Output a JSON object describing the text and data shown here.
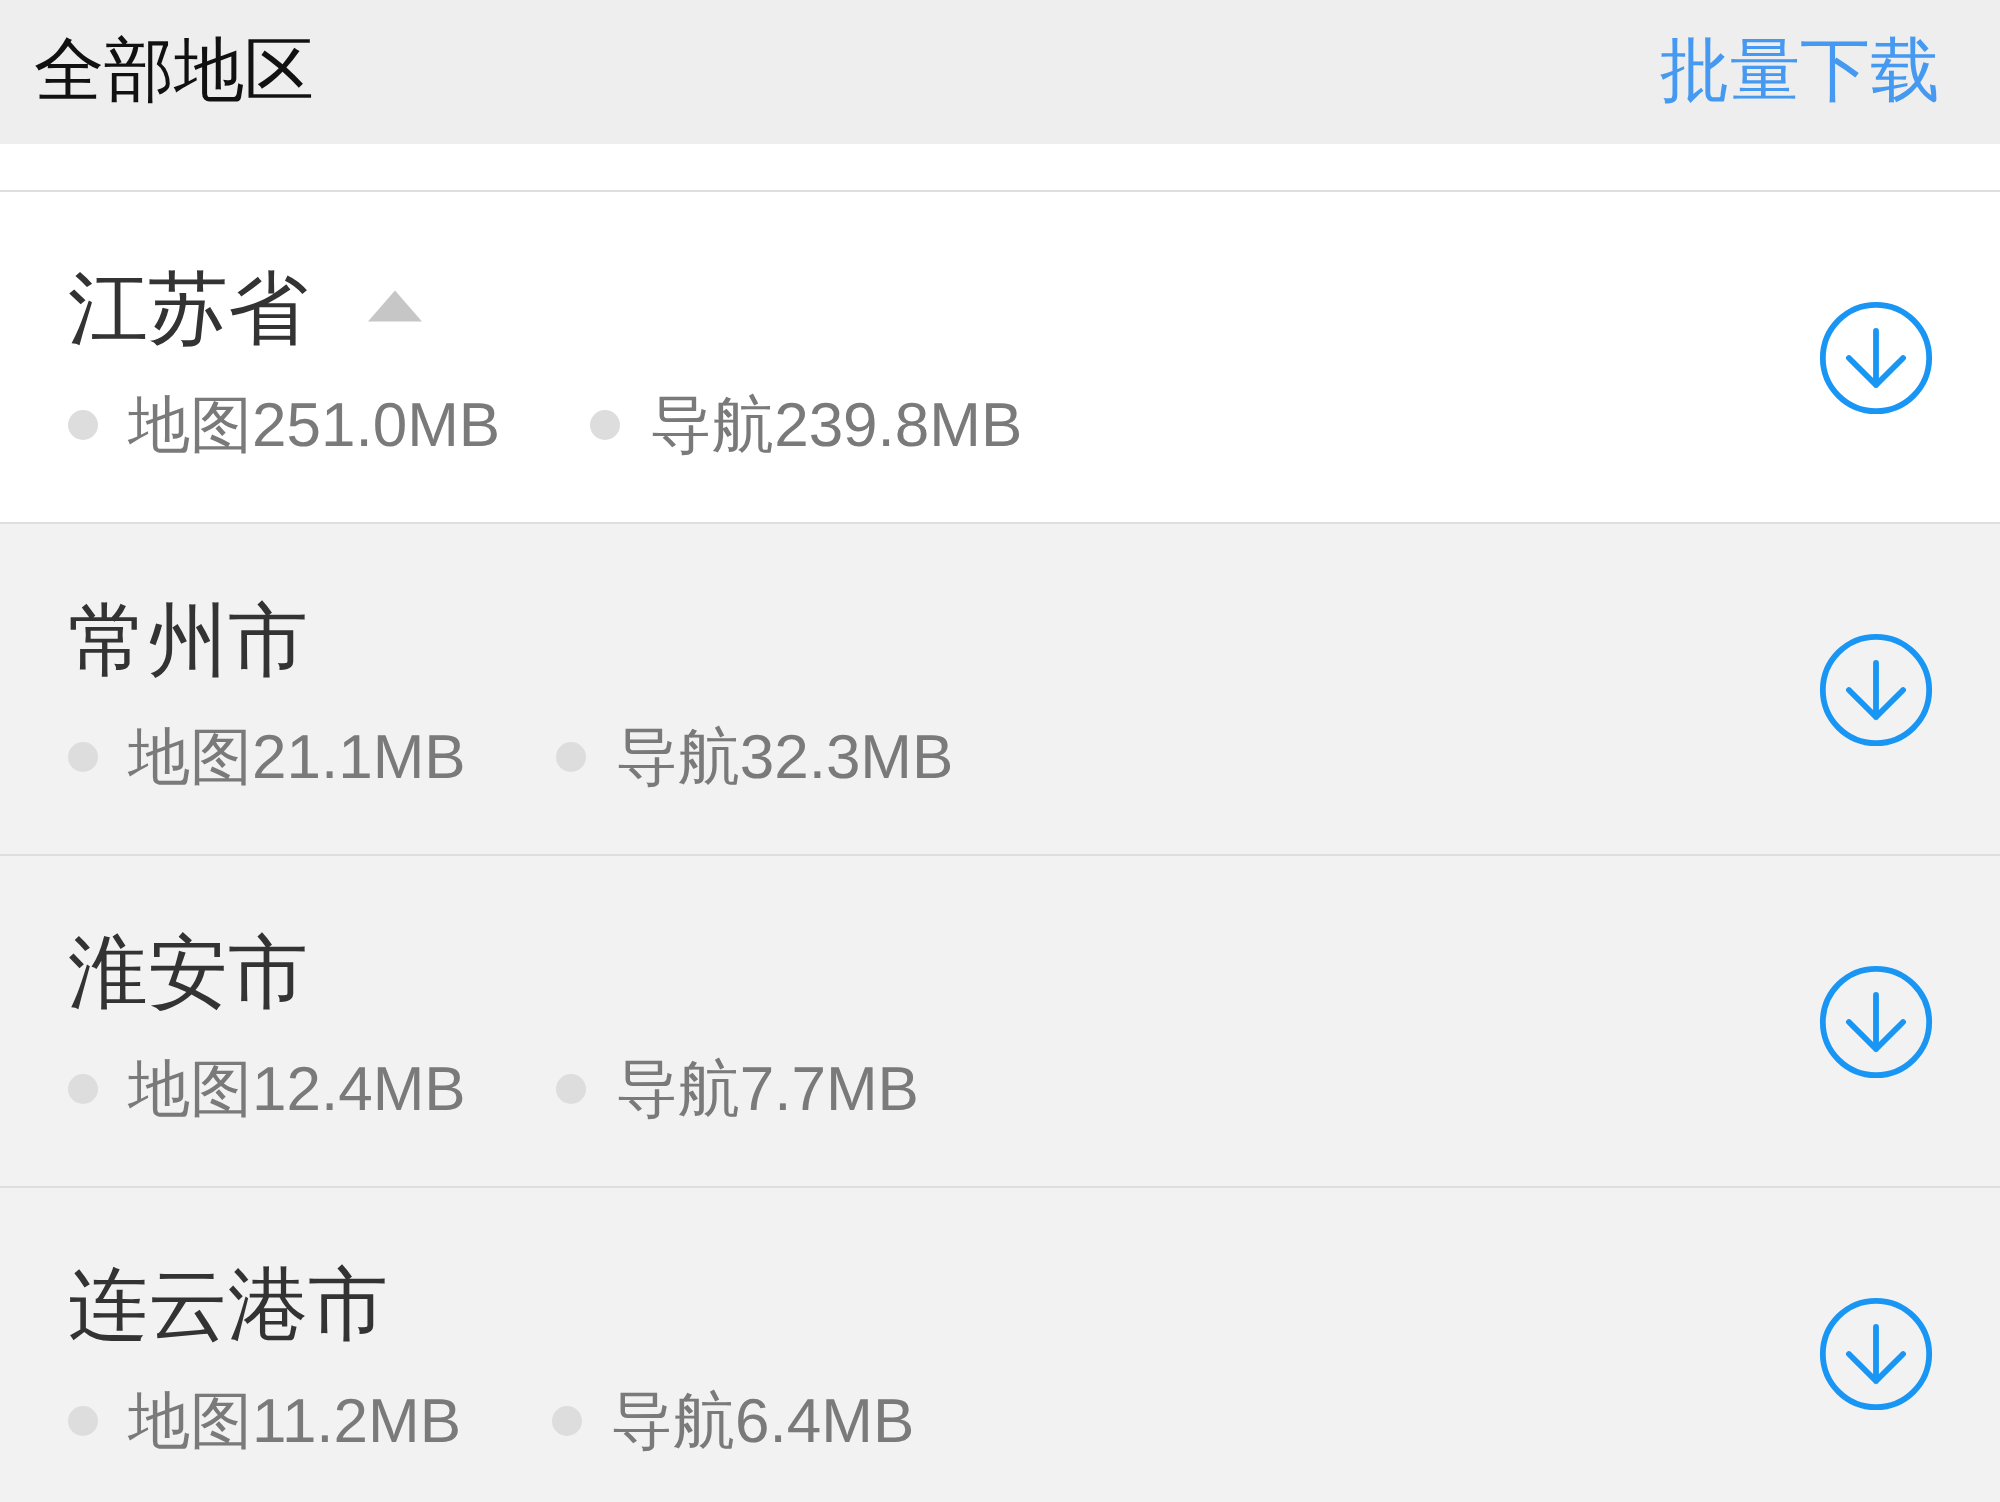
{
  "header": {
    "title": "全部地区",
    "action": "批量下载"
  },
  "regions": [
    {
      "name": "江苏省",
      "expanded": true,
      "map": "地图251.0MB",
      "navigation": "导航239.8MB",
      "children": [
        {
          "name": "常州市",
          "map": "地图21.1MB",
          "navigation": "导航32.3MB"
        },
        {
          "name": "淮安市",
          "map": "地图12.4MB",
          "navigation": "导航7.7MB"
        },
        {
          "name": "连云港市",
          "map": "地图11.2MB",
          "navigation": "导航6.4MB"
        }
      ]
    }
  ]
}
